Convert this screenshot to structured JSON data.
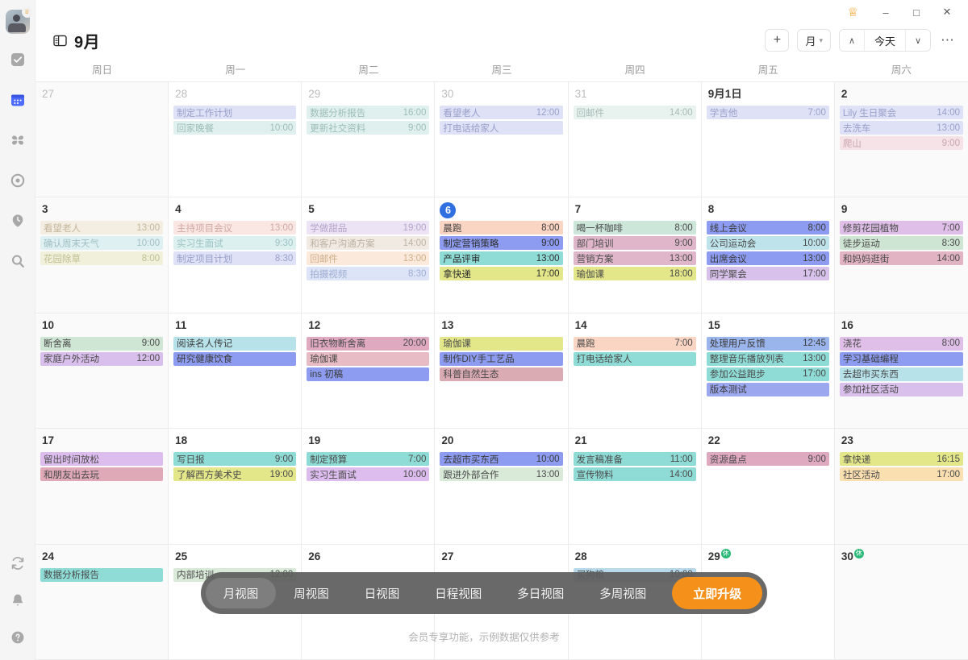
{
  "titlebar": {
    "crown_icon": "crown-icon",
    "minimize": "–",
    "maximize": "□",
    "close": "✕"
  },
  "header": {
    "panel_icon": "panel-layout-icon",
    "title": "9月",
    "add_label": "+",
    "view_label": "月",
    "prev_label": "∧",
    "today_label": "今天",
    "next_label": "∨",
    "more_label": "⋯"
  },
  "sidebar": {
    "avatar": "user-avatar",
    "items": [
      {
        "icon": "task-check-icon",
        "active": false
      },
      {
        "icon": "calendar-icon",
        "active": true
      },
      {
        "icon": "four-squares-grid-icon",
        "active": false
      },
      {
        "icon": "target-focus-icon",
        "active": false
      },
      {
        "icon": "pomodoro-clock-icon",
        "active": false
      },
      {
        "icon": "search-icon",
        "active": false
      }
    ],
    "bottom_items": [
      {
        "icon": "sync-refresh-icon"
      },
      {
        "icon": "bell-notification-icon"
      },
      {
        "icon": "help-question-icon"
      }
    ]
  },
  "weekdays": [
    "周日",
    "周一",
    "周二",
    "周三",
    "周四",
    "周五",
    "周六"
  ],
  "colors": {
    "accent_blue": "#2f6fe0",
    "upgrade_orange": "#f5901a",
    "rest_green": "#28b877",
    "crown_gold": "#f59a16"
  },
  "calendar": {
    "weeks": [
      [
        {
          "day": "27",
          "outside": true,
          "weekend": true,
          "events": []
        },
        {
          "day": "28",
          "outside": true,
          "events": [
            {
              "title": "制定工作计划",
              "time": "",
              "bg": "#dfe1f7",
              "fg": "#9aa0c8"
            },
            {
              "title": "回家晚餐",
              "time": "10:00",
              "bg": "#dff0ee",
              "fg": "#9dbdb8"
            }
          ]
        },
        {
          "day": "29",
          "outside": true,
          "events": [
            {
              "title": "数据分析报告",
              "time": "16:00",
              "bg": "#dff0ee",
              "fg": "#9dbdb8"
            },
            {
              "title": "更新社交资料",
              "time": "9:00",
              "bg": "#dff0ee",
              "fg": "#9dbdb8"
            }
          ]
        },
        {
          "day": "30",
          "outside": true,
          "events": [
            {
              "title": "看望老人",
              "time": "12:00",
              "bg": "#dfe1f7",
              "fg": "#9aa0c8"
            },
            {
              "title": "打电话给家人",
              "time": "",
              "bg": "#dfe1f7",
              "fg": "#9aa0c8"
            }
          ]
        },
        {
          "day": "31",
          "outside": true,
          "events": [
            {
              "title": "回邮件",
              "time": "14:00",
              "bg": "#e8f2ef",
              "fg": "#a8bcb7"
            }
          ]
        },
        {
          "day": "9月1日",
          "outside": false,
          "events": [
            {
              "title": "学吉他",
              "time": "7:00",
              "bg": "#dfe1f7",
              "fg": "#9aa0c8"
            }
          ]
        },
        {
          "day": "2",
          "outside": false,
          "weekend": true,
          "events": [
            {
              "title": "Lily 生日聚会",
              "time": "14:00",
              "bg": "#dfe1f7",
              "fg": "#9aa0c8"
            },
            {
              "title": "去洗车",
              "time": "13:00",
              "bg": "#dfe1f7",
              "fg": "#9aa0c8"
            },
            {
              "title": "爬山",
              "time": "9:00",
              "bg": "#f5e3e7",
              "fg": "#c9a6ae"
            }
          ]
        }
      ],
      [
        {
          "day": "3",
          "outside": false,
          "weekend": true,
          "events": [
            {
              "title": "看望老人",
              "time": "13:00",
              "bg": "#f3ede2",
              "fg": "#c4b69c"
            },
            {
              "title": "确认周末天气",
              "time": "10:00",
              "bg": "#dff0f2",
              "fg": "#a0bfc4"
            },
            {
              "title": "花园除草",
              "time": "8:00",
              "bg": "#f1f0da",
              "fg": "#c1bf93"
            }
          ]
        },
        {
          "day": "4",
          "outside": false,
          "events": [
            {
              "title": "主持项目会议",
              "time": "13:00",
              "bg": "#fae7e4",
              "fg": "#cfa8a2"
            },
            {
              "title": "实习生面试",
              "time": "9:30",
              "bg": "#ddf0f0",
              "fg": "#9cc2c2"
            },
            {
              "title": "制定项目计划",
              "time": "8:30",
              "bg": "#dfe1f7",
              "fg": "#9aa0c8"
            }
          ]
        },
        {
          "day": "5",
          "outside": false,
          "events": [
            {
              "title": "学做甜品",
              "time": "19:00",
              "bg": "#ece3f5",
              "fg": "#b3a3c8"
            },
            {
              "title": "和客户沟通方案",
              "time": "14:00",
              "bg": "#f0eae2",
              "fg": "#bdb2a4"
            },
            {
              "title": "回邮件",
              "time": "13:00",
              "bg": "#fbeadb",
              "fg": "#cfae8b"
            },
            {
              "title": "拍摄视频",
              "time": "8:30",
              "bg": "#dde4f7",
              "fg": "#9fadd1"
            }
          ]
        },
        {
          "day": "6",
          "outside": false,
          "today": true,
          "events": [
            {
              "title": "晨跑",
              "time": "8:00",
              "bg": "#fad5c3",
              "fg": "#3d3d3d"
            },
            {
              "title": "制定营销策略",
              "time": "9:00",
              "bg": "#8d9cf0",
              "fg": "#2c2c2c"
            },
            {
              "title": "产品评审",
              "time": "13:00",
              "bg": "#8fdcd7",
              "fg": "#2c2c2c"
            },
            {
              "title": "拿快递",
              "time": "17:00",
              "bg": "#e3e78a",
              "fg": "#2c2c2c"
            }
          ]
        },
        {
          "day": "7",
          "outside": false,
          "events": [
            {
              "title": "喝一杯咖啡",
              "time": "8:00",
              "bg": "#cce6d9",
              "fg": "#4a4a4a"
            },
            {
              "title": "部门培训",
              "time": "9:00",
              "bg": "#e0b7ca",
              "fg": "#4a4a4a"
            },
            {
              "title": "营销方案",
              "time": "13:00",
              "bg": "#e0b7ca",
              "fg": "#4a4a4a"
            },
            {
              "title": "瑜伽课",
              "time": "18:00",
              "bg": "#e3e78a",
              "fg": "#4a4a4a"
            }
          ]
        },
        {
          "day": "8",
          "outside": false,
          "events": [
            {
              "title": "线上会议",
              "time": "8:00",
              "bg": "#8d9cf0",
              "fg": "#3b3b3b"
            },
            {
              "title": "公司运动会",
              "time": "10:00",
              "bg": "#bfe3ea",
              "fg": "#4a4a4a"
            },
            {
              "title": "出席会议",
              "time": "13:00",
              "bg": "#8d9cf0",
              "fg": "#3b3b3b"
            },
            {
              "title": "同学聚会",
              "time": "17:00",
              "bg": "#d8c2ec",
              "fg": "#4a4a4a"
            }
          ]
        },
        {
          "day": "9",
          "outside": false,
          "weekend": true,
          "events": [
            {
              "title": "修剪花园植物",
              "time": "7:00",
              "bg": "#dfbfe8",
              "fg": "#4a4a4a"
            },
            {
              "title": "徒步运动",
              "time": "8:30",
              "bg": "#cee5d3",
              "fg": "#4a4a4a"
            },
            {
              "title": "和妈妈逛街",
              "time": "14:00",
              "bg": "#e2b3c3",
              "fg": "#4a4a4a"
            }
          ]
        }
      ],
      [
        {
          "day": "10",
          "outside": false,
          "weekend": true,
          "events": [
            {
              "title": "断舍离",
              "time": "9:00",
              "bg": "#cfe6d4",
              "fg": "#4a4a4a"
            },
            {
              "title": "家庭户外活动",
              "time": "12:00",
              "bg": "#d9bfeb",
              "fg": "#4a4a4a"
            }
          ]
        },
        {
          "day": "11",
          "outside": false,
          "events": [
            {
              "title": "阅读名人传记",
              "time": "",
              "bg": "#b7e2ea",
              "fg": "#3d3d3d"
            },
            {
              "title": "研究健康饮食",
              "time": "",
              "bg": "#8d9cf0",
              "fg": "#3b3b3b"
            }
          ]
        },
        {
          "day": "12",
          "outside": false,
          "events": [
            {
              "title": "旧衣物断舍离",
              "time": "20:00",
              "bg": "#dfa9c0",
              "fg": "#4a4a4a"
            },
            {
              "title": "瑜伽课",
              "time": "",
              "bg": "#e8bcc4",
              "fg": "#4a4a4a"
            },
            {
              "title": "ins 初稿",
              "time": "",
              "bg": "#8d9cf0",
              "fg": "#3b3b3b"
            }
          ]
        },
        {
          "day": "13",
          "outside": false,
          "events": [
            {
              "title": "瑜伽课",
              "time": "",
              "bg": "#e3e78a",
              "fg": "#4a4a4a"
            },
            {
              "title": "制作DIY手工艺品",
              "time": "",
              "bg": "#8d9cf0",
              "fg": "#3b3b3b"
            },
            {
              "title": "科普自然生态",
              "time": "",
              "bg": "#dbabb4",
              "fg": "#4a4a4a"
            }
          ]
        },
        {
          "day": "14",
          "outside": false,
          "events": [
            {
              "title": "晨跑",
              "time": "7:00",
              "bg": "#fad5c3",
              "fg": "#4a4a4a"
            },
            {
              "title": "打电话给家人",
              "time": "",
              "bg": "#8fdcd7",
              "fg": "#4a4a4a"
            }
          ]
        },
        {
          "day": "15",
          "outside": false,
          "events": [
            {
              "title": "处理用户反馈",
              "time": "12:45",
              "bg": "#9ab4ec",
              "fg": "#3b3b3b"
            },
            {
              "title": "整理音乐播放列表",
              "time": "13:00",
              "bg": "#8fdcd7",
              "fg": "#4a4a4a"
            },
            {
              "title": "参加公益跑步",
              "time": "17:00",
              "bg": "#8fdcd7",
              "fg": "#4a4a4a"
            },
            {
              "title": "版本测试",
              "time": "",
              "bg": "#9ba7ef",
              "fg": "#3b3b3b"
            }
          ]
        },
        {
          "day": "16",
          "outside": false,
          "weekend": true,
          "events": [
            {
              "title": "浇花",
              "time": "8:00",
              "bg": "#dfbfe8",
              "fg": "#4a4a4a"
            },
            {
              "title": "学习基础编程",
              "time": "",
              "bg": "#8d9cf0",
              "fg": "#3b3b3b"
            },
            {
              "title": "去超市买东西",
              "time": "",
              "bg": "#b7e2ea",
              "fg": "#4a4a4a"
            },
            {
              "title": "参加社区活动",
              "time": "",
              "bg": "#d9bfeb",
              "fg": "#4a4a4a"
            }
          ]
        }
      ],
      [
        {
          "day": "17",
          "outside": false,
          "weekend": true,
          "events": [
            {
              "title": "留出时间放松",
              "time": "",
              "bg": "#dcbdee",
              "fg": "#4a4a4a"
            },
            {
              "title": "和朋友出去玩",
              "time": "",
              "bg": "#dfa9b8",
              "fg": "#4a4a4a"
            }
          ]
        },
        {
          "day": "18",
          "outside": false,
          "events": [
            {
              "title": "写日报",
              "time": "9:00",
              "bg": "#8fdcd7",
              "fg": "#4a4a4a"
            },
            {
              "title": "了解西方美术史",
              "time": "19:00",
              "bg": "#e3e78a",
              "fg": "#4a4a4a"
            }
          ]
        },
        {
          "day": "19",
          "outside": false,
          "events": [
            {
              "title": "制定预算",
              "time": "7:00",
              "bg": "#8fdcd7",
              "fg": "#4a4a4a"
            },
            {
              "title": "实习生面试",
              "time": "10:00",
              "bg": "#dcbdee",
              "fg": "#4a4a4a"
            }
          ]
        },
        {
          "day": "20",
          "outside": false,
          "events": [
            {
              "title": "去超市买东西",
              "time": "10:00",
              "bg": "#8d9cf0",
              "fg": "#3b3b3b"
            },
            {
              "title": "跟进外部合作",
              "time": "13:00",
              "bg": "#d9ead9",
              "fg": "#4a4a4a"
            }
          ]
        },
        {
          "day": "21",
          "outside": false,
          "events": [
            {
              "title": "发言稿准备",
              "time": "11:00",
              "bg": "#8fdcd7",
              "fg": "#4a4a4a"
            },
            {
              "title": "宣传物料",
              "time": "14:00",
              "bg": "#8fdcd7",
              "fg": "#4a4a4a"
            }
          ]
        },
        {
          "day": "22",
          "outside": false,
          "events": [
            {
              "title": "资源盘点",
              "time": "9:00",
              "bg": "#dfa9c0",
              "fg": "#4a4a4a"
            }
          ]
        },
        {
          "day": "23",
          "outside": false,
          "weekend": true,
          "events": [
            {
              "title": "拿快递",
              "time": "16:15",
              "bg": "#e3e78a",
              "fg": "#4a4a4a"
            },
            {
              "title": "社区活动",
              "time": "17:00",
              "bg": "#fadfb0",
              "fg": "#4a4a4a"
            }
          ]
        }
      ],
      [
        {
          "day": "24",
          "outside": false,
          "weekend": true,
          "events": [
            {
              "title": "数据分析报告",
              "time": "",
              "bg": "#8fdcd7",
              "fg": "#4a4a4a"
            }
          ]
        },
        {
          "day": "25",
          "outside": false,
          "events": [
            {
              "title": "内部培训",
              "time": "12:00",
              "bg": "#d9ead9",
              "fg": "#4a4a4a"
            }
          ]
        },
        {
          "day": "26",
          "outside": false,
          "events": []
        },
        {
          "day": "27",
          "outside": false,
          "events": []
        },
        {
          "day": "28",
          "outside": false,
          "events": [
            {
              "title": "买狗粮",
              "time": "10:00",
              "bg": "#b7d9ea",
              "fg": "#4a4a4a"
            }
          ]
        },
        {
          "day": "29",
          "outside": false,
          "rest": "休",
          "events": []
        },
        {
          "day": "30",
          "outside": false,
          "weekend": true,
          "rest": "休",
          "events": []
        }
      ]
    ]
  },
  "viewbar": {
    "items": [
      {
        "label": "月视图",
        "active": true
      },
      {
        "label": "周视图",
        "active": false
      },
      {
        "label": "日视图",
        "active": false
      },
      {
        "label": "日程视图",
        "active": false
      },
      {
        "label": "多日视图",
        "active": false
      },
      {
        "label": "多周视图",
        "active": false
      }
    ],
    "upgrade_label": "立即升级",
    "footnote": "会员专享功能，示例数据仅供参考"
  }
}
